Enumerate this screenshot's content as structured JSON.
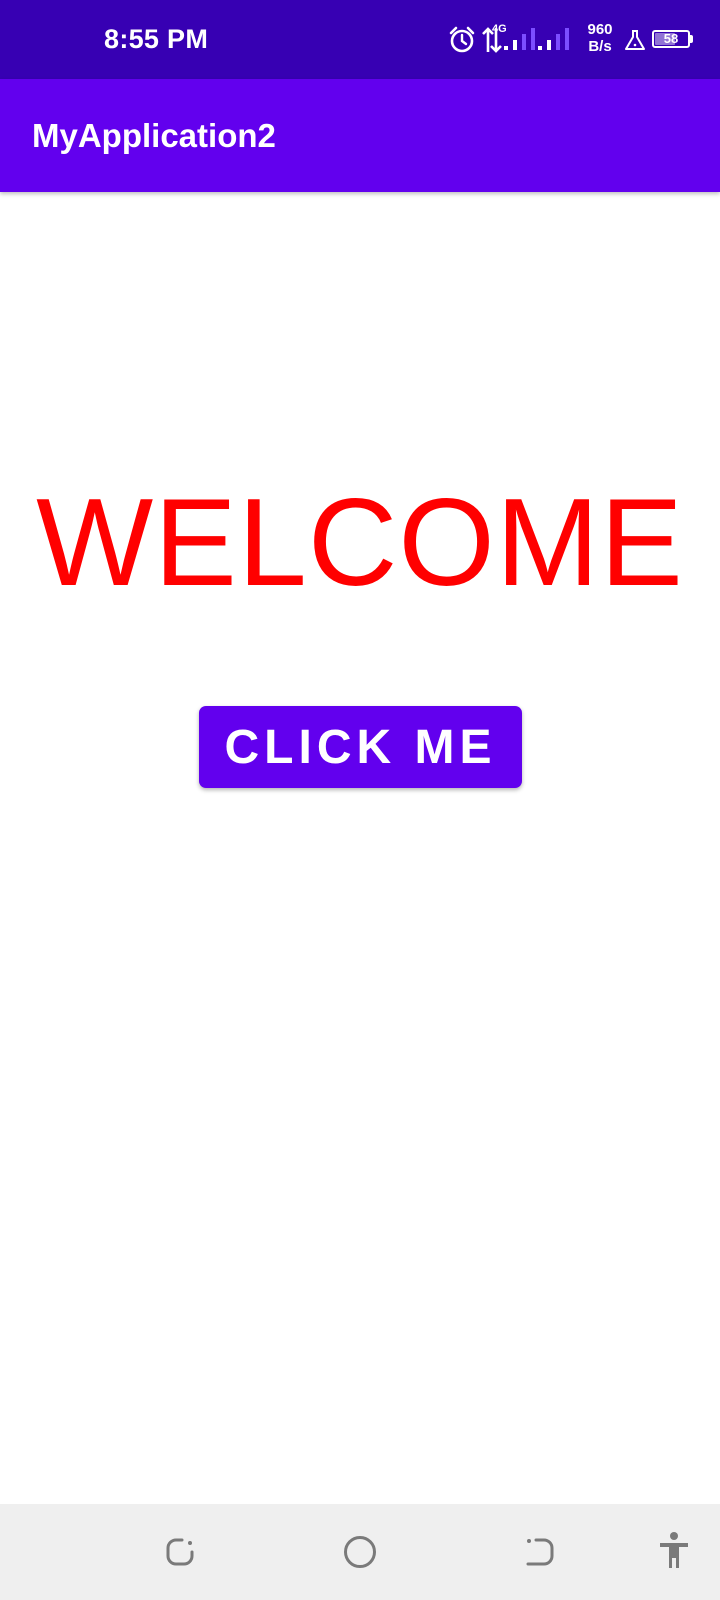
{
  "status_bar": {
    "time": "8:55 PM",
    "network_type": "4G",
    "net_speed_value": "960",
    "net_speed_unit": "B/s",
    "battery_level": "58",
    "icons": [
      "alarm-icon",
      "data-transfer-icon",
      "signal-icon",
      "signal-icon",
      "lab-flask-icon",
      "battery-icon"
    ]
  },
  "app_bar": {
    "title": "MyApplication2",
    "color": "#6200ee"
  },
  "main": {
    "welcome_text": "WELCOME",
    "welcome_color": "#ff0000",
    "button_label": "CLICK ME",
    "button_color": "#6200ee"
  },
  "nav_bar": {
    "icons": [
      "menu-icon",
      "home-icon",
      "back-icon",
      "accessibility-icon"
    ]
  }
}
